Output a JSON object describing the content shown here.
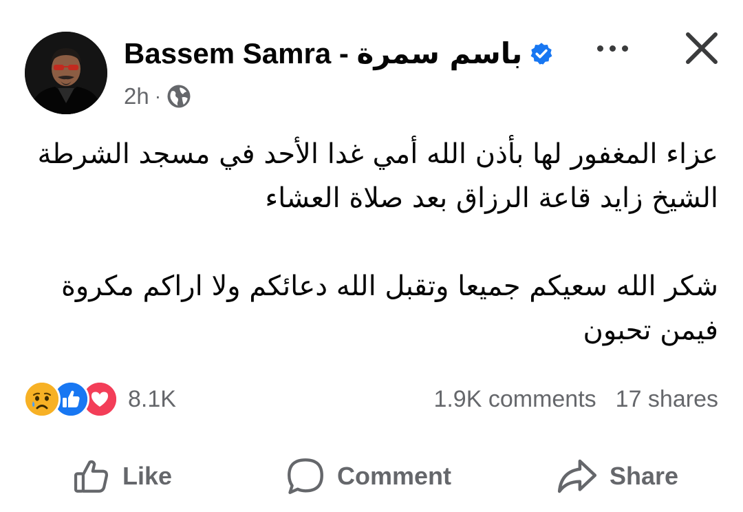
{
  "post": {
    "author": {
      "name_latin": "Bassem Samra - ",
      "name_arabic": "باسم سمرة",
      "verified": true
    },
    "time": "2h",
    "separator": "·",
    "privacy_icon": "globe-icon",
    "body_lines": [
      "عزاء المغفور لها بأذن الله أمي غدا الأحد في مسجد الشرطة",
      "الشيخ زايد قاعة الرزاق بعد صلاة العشاء",
      "شكر الله سعيكم جميعا وتقبل الله دعائكم ولا اراكم مكروة",
      "فيمن تحبون"
    ]
  },
  "reactions": {
    "icons": [
      "sad-reaction-icon",
      "like-reaction-icon",
      "love-reaction-icon"
    ],
    "count": "8.1K"
  },
  "stats": {
    "comments": "1.9K comments",
    "shares": "17 shares"
  },
  "actions": {
    "like": "Like",
    "comment": "Comment",
    "share": "Share"
  },
  "colors": {
    "accent_blue": "#1877f2",
    "love_red": "#f33e58",
    "secondary_text": "#65676b",
    "primary_text": "#050505"
  }
}
